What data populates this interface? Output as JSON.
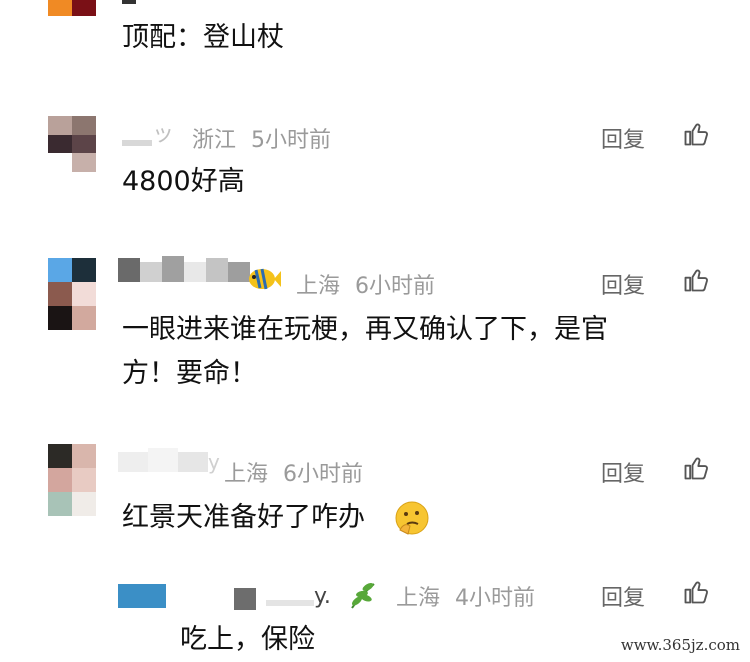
{
  "comments": [
    {
      "location": "",
      "time": "",
      "text": "顶配：登山杖",
      "reply": "",
      "avatar_colors": [
        "#f08a24",
        "#7a1016"
      ]
    },
    {
      "location": "浙江",
      "time": "5小时前",
      "text": "4800好高",
      "reply": "回复",
      "avatar_colors": [
        "#b9a19a",
        "#8c766f",
        "#3a2a30",
        "#5c4448",
        "#c7b0aa",
        "#e8dcd8"
      ]
    },
    {
      "location": "上海",
      "time": "6小时前",
      "text_line1": "一眼进来谁在玩梗，再又确认了下，是官",
      "text_line2": "方！要命！",
      "reply": "回复",
      "avatar_colors": [
        "#5aa7e6",
        "#1d2f3a",
        "#8b5a4e",
        "#f2dcd8",
        "#1a1414",
        "#d2a99e"
      ]
    },
    {
      "location": "上海",
      "time": "6小时前",
      "text": "红景天准备好了咋办",
      "reply": "回复",
      "avatar_colors": [
        "#2c2a26",
        "#d9b6ac",
        "#d3a69e",
        "#e8cbc3",
        "#a8c3b7",
        "#f0ece8"
      ]
    },
    {
      "location": "上海",
      "time": "4小时前",
      "text": "吃上，保险",
      "reply": "回复",
      "avatar_colors": [
        "#3b8fc6",
        "#6d6d6d"
      ]
    }
  ],
  "watermark": "www.365jz.com",
  "icons": {
    "like": "thumbs-up-icon",
    "fish": "fish-emoji-icon",
    "leaf": "leaf-emoji-icon",
    "thinking": "thinking-face-emoji-icon"
  }
}
